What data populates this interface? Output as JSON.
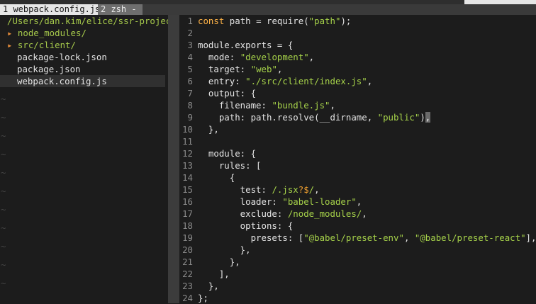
{
  "tabs": [
    {
      "label": "1 webpack.config.js"
    },
    {
      "label": "2 zsh -"
    }
  ],
  "tree": {
    "root": "/Users/dan.kim/elice/ssr-project/",
    "items": [
      {
        "label": "node_modules/",
        "kind": "dir"
      },
      {
        "label": "src/client/",
        "kind": "dir"
      },
      {
        "label": "package-lock.json",
        "kind": "file"
      },
      {
        "label": "package.json",
        "kind": "file"
      },
      {
        "label": "webpack.config.js",
        "kind": "file",
        "selected": true
      }
    ],
    "tilde": "~"
  },
  "editor": {
    "lines": [
      {
        "n": "1"
      },
      {
        "n": "2"
      },
      {
        "n": "3"
      },
      {
        "n": "4"
      },
      {
        "n": "5"
      },
      {
        "n": "6"
      },
      {
        "n": "7"
      },
      {
        "n": "8"
      },
      {
        "n": "9"
      },
      {
        "n": "10"
      },
      {
        "n": "11"
      },
      {
        "n": "12"
      },
      {
        "n": "13"
      },
      {
        "n": "14"
      },
      {
        "n": "15"
      },
      {
        "n": "16"
      },
      {
        "n": "17"
      },
      {
        "n": "18"
      },
      {
        "n": "19"
      },
      {
        "n": "20"
      },
      {
        "n": "21"
      },
      {
        "n": "22"
      },
      {
        "n": "23"
      },
      {
        "n": "24"
      }
    ],
    "tokens": {
      "l1_kw": "const",
      "l1_a": " path = require(",
      "l1_s": "\"path\"",
      "l1_b": ");",
      "l3": "module.exports = {",
      "l4_a": "  mode: ",
      "l4_s": "\"development\"",
      "l4_b": ",",
      "l5_a": "  target: ",
      "l5_s": "\"web\"",
      "l5_b": ",",
      "l6_a": "  entry: ",
      "l6_s": "\"./src/client/index.js\"",
      "l6_b": ",",
      "l7": "  output: {",
      "l8_a": "    filename: ",
      "l8_s": "\"bundle.js\"",
      "l8_b": ",",
      "l9_a": "    path: path.resolve(__dirname, ",
      "l9_s": "\"public\"",
      "l9_b": ")",
      "l9_c": ",",
      "l10": "  },",
      "l12": "  module: {",
      "l13": "    rules: [",
      "l14": "      {",
      "l15_a": "        test: ",
      "l15_r1": "/.jsx",
      "l15_r2": "?$",
      "l15_r3": "/",
      "l15_b": ",",
      "l16_a": "        loader: ",
      "l16_s": "\"babel-loader\"",
      "l16_b": ",",
      "l17_a": "        exclude: ",
      "l17_r": "/node_modules/",
      "l17_b": ",",
      "l18": "        options: {",
      "l19_a": "          presets: [",
      "l19_s1": "\"@babel/preset-env\"",
      "l19_m": ", ",
      "l19_s2": "\"@babel/preset-react\"",
      "l19_b": "],",
      "l20": "        },",
      "l21": "      },",
      "l22": "    ],",
      "l23": "  },",
      "l24": "};"
    }
  },
  "colors": {
    "background": "#1c1c1c",
    "keyword": "#ffb347",
    "string": "#a6d24a",
    "directory": "#a6c94b",
    "arrow": "#e38b3a",
    "line_number": "#8a8a8a"
  }
}
